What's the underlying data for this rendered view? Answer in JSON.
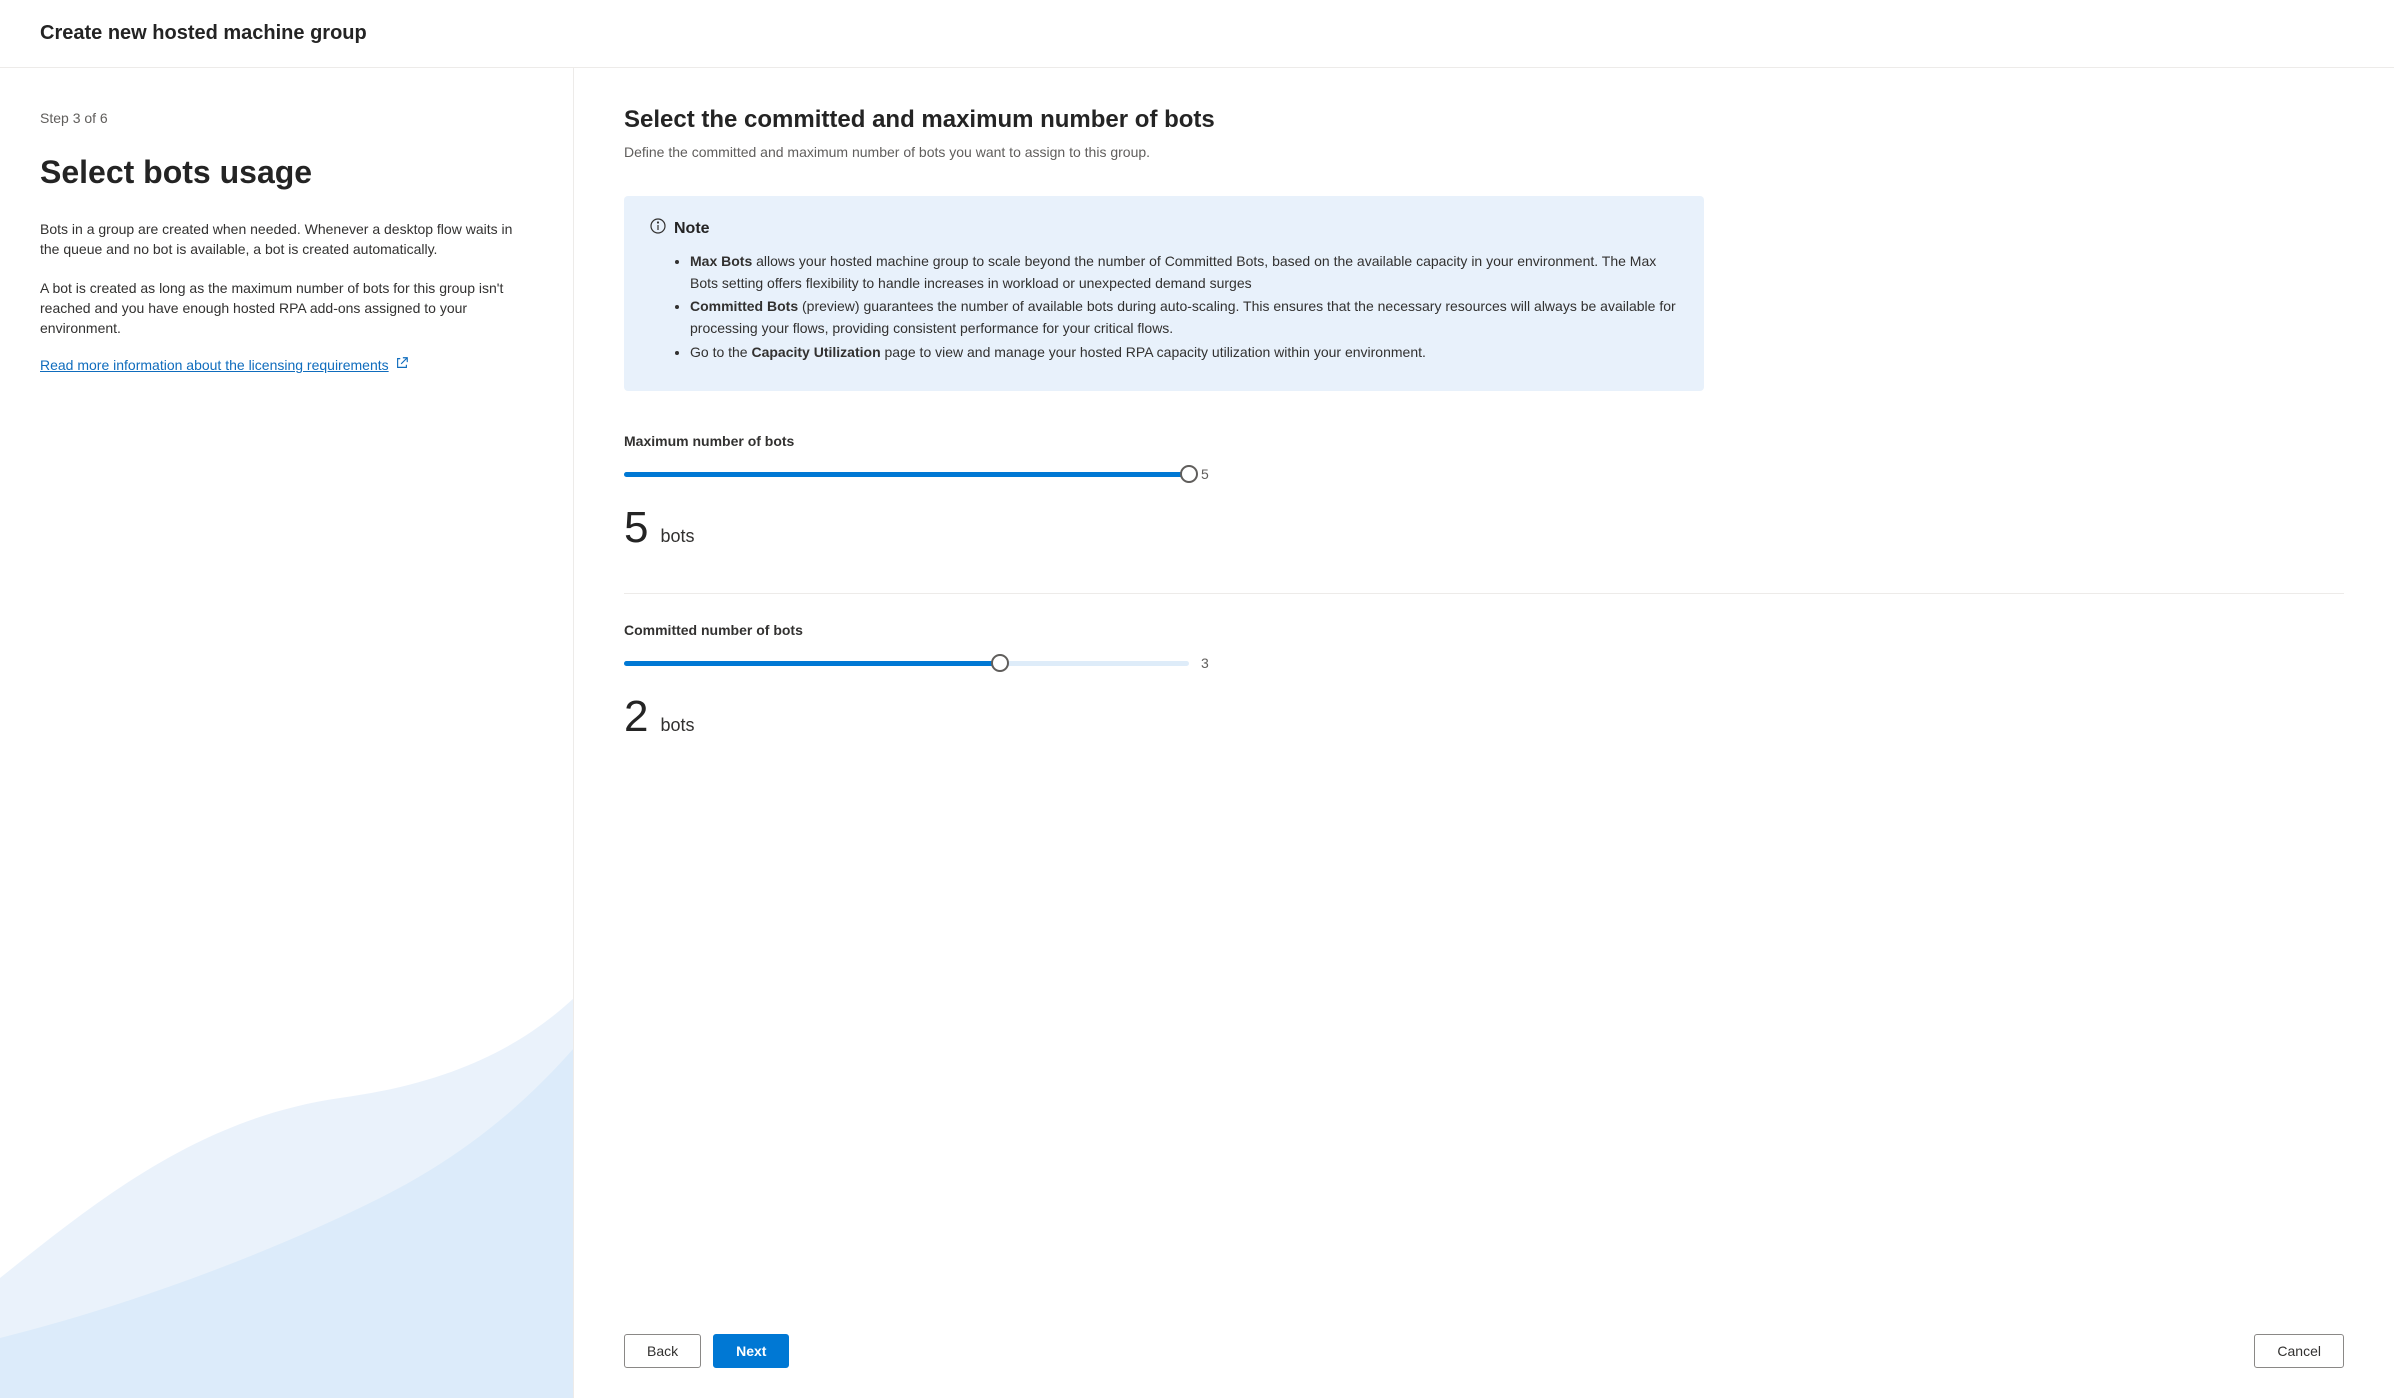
{
  "header": {
    "title": "Create new hosted machine group"
  },
  "sidebar": {
    "step": "Step 3 of 6",
    "title": "Select bots usage",
    "para1": "Bots in a group are created when needed. Whenever a desktop flow waits in the queue and no bot is available, a bot is created automatically.",
    "para2": "A bot is created as long as the maximum number of bots for this group isn't reached and you have enough hosted RPA add-ons assigned to your environment.",
    "link_text": "Read more information about the licensing requirements"
  },
  "main": {
    "title": "Select the committed and maximum number of bots",
    "subtitle": "Define the committed and maximum number of bots you want to assign to this group."
  },
  "note": {
    "heading": "Note",
    "item1_bold": "Max Bots",
    "item1_rest": " allows your hosted machine group to scale beyond the number of Committed Bots, based on the available capacity in your environment. The Max Bots setting offers flexibility to handle increases in workload or unexpected demand surges",
    "item2_bold": "Committed Bots",
    "item2_rest": " (preview) guarantees the number of available bots during auto-scaling. This ensures that the necessary resources will always be available for processing your flows, providing consistent performance for your critical flows.",
    "item3_pre": "Go to the ",
    "item3_bold": "Capacity Utilization",
    "item3_rest": " page to view and manage your hosted RPA capacity utilization within your environment."
  },
  "sliders": {
    "max": {
      "label": "Maximum number of bots",
      "value": "5",
      "max_label": "5",
      "unit": "bots",
      "fill_pct": "100%",
      "thumb_pct": "100%"
    },
    "committed": {
      "label": "Committed number of bots",
      "value": "2",
      "max_label": "3",
      "unit": "bots",
      "fill_pct": "66.6%",
      "thumb_pct": "66.6%"
    }
  },
  "footer": {
    "back": "Back",
    "next": "Next",
    "cancel": "Cancel"
  }
}
